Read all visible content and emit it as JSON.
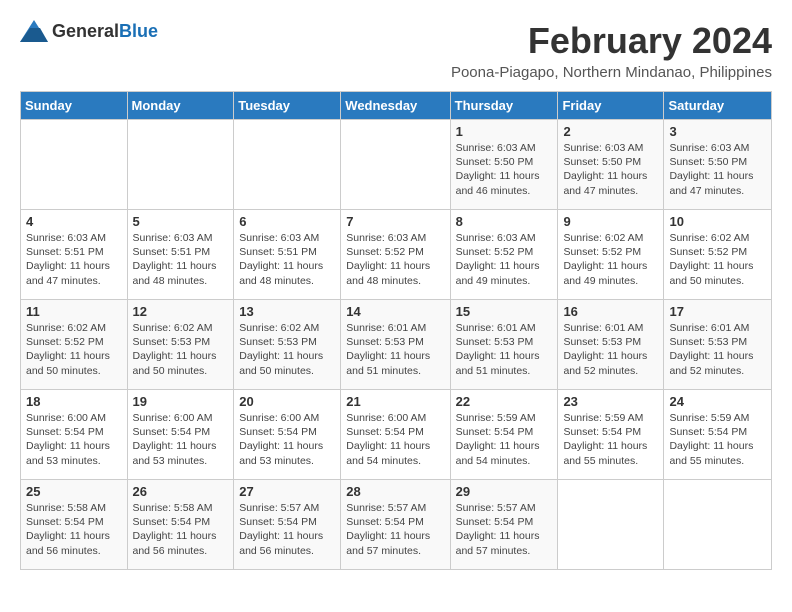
{
  "logo": {
    "general": "General",
    "blue": "Blue"
  },
  "title": "February 2024",
  "location": "Poona-Piagapo, Northern Mindanao, Philippines",
  "weekdays": [
    "Sunday",
    "Monday",
    "Tuesday",
    "Wednesday",
    "Thursday",
    "Friday",
    "Saturday"
  ],
  "weeks": [
    [
      {
        "day": "",
        "info": ""
      },
      {
        "day": "",
        "info": ""
      },
      {
        "day": "",
        "info": ""
      },
      {
        "day": "",
        "info": ""
      },
      {
        "day": "1",
        "info": "Sunrise: 6:03 AM\nSunset: 5:50 PM\nDaylight: 11 hours and 46 minutes."
      },
      {
        "day": "2",
        "info": "Sunrise: 6:03 AM\nSunset: 5:50 PM\nDaylight: 11 hours and 47 minutes."
      },
      {
        "day": "3",
        "info": "Sunrise: 6:03 AM\nSunset: 5:50 PM\nDaylight: 11 hours and 47 minutes."
      }
    ],
    [
      {
        "day": "4",
        "info": "Sunrise: 6:03 AM\nSunset: 5:51 PM\nDaylight: 11 hours and 47 minutes."
      },
      {
        "day": "5",
        "info": "Sunrise: 6:03 AM\nSunset: 5:51 PM\nDaylight: 11 hours and 48 minutes."
      },
      {
        "day": "6",
        "info": "Sunrise: 6:03 AM\nSunset: 5:51 PM\nDaylight: 11 hours and 48 minutes."
      },
      {
        "day": "7",
        "info": "Sunrise: 6:03 AM\nSunset: 5:52 PM\nDaylight: 11 hours and 48 minutes."
      },
      {
        "day": "8",
        "info": "Sunrise: 6:03 AM\nSunset: 5:52 PM\nDaylight: 11 hours and 49 minutes."
      },
      {
        "day": "9",
        "info": "Sunrise: 6:02 AM\nSunset: 5:52 PM\nDaylight: 11 hours and 49 minutes."
      },
      {
        "day": "10",
        "info": "Sunrise: 6:02 AM\nSunset: 5:52 PM\nDaylight: 11 hours and 50 minutes."
      }
    ],
    [
      {
        "day": "11",
        "info": "Sunrise: 6:02 AM\nSunset: 5:52 PM\nDaylight: 11 hours and 50 minutes."
      },
      {
        "day": "12",
        "info": "Sunrise: 6:02 AM\nSunset: 5:53 PM\nDaylight: 11 hours and 50 minutes."
      },
      {
        "day": "13",
        "info": "Sunrise: 6:02 AM\nSunset: 5:53 PM\nDaylight: 11 hours and 50 minutes."
      },
      {
        "day": "14",
        "info": "Sunrise: 6:01 AM\nSunset: 5:53 PM\nDaylight: 11 hours and 51 minutes."
      },
      {
        "day": "15",
        "info": "Sunrise: 6:01 AM\nSunset: 5:53 PM\nDaylight: 11 hours and 51 minutes."
      },
      {
        "day": "16",
        "info": "Sunrise: 6:01 AM\nSunset: 5:53 PM\nDaylight: 11 hours and 52 minutes."
      },
      {
        "day": "17",
        "info": "Sunrise: 6:01 AM\nSunset: 5:53 PM\nDaylight: 11 hours and 52 minutes."
      }
    ],
    [
      {
        "day": "18",
        "info": "Sunrise: 6:00 AM\nSunset: 5:54 PM\nDaylight: 11 hours and 53 minutes."
      },
      {
        "day": "19",
        "info": "Sunrise: 6:00 AM\nSunset: 5:54 PM\nDaylight: 11 hours and 53 minutes."
      },
      {
        "day": "20",
        "info": "Sunrise: 6:00 AM\nSunset: 5:54 PM\nDaylight: 11 hours and 53 minutes."
      },
      {
        "day": "21",
        "info": "Sunrise: 6:00 AM\nSunset: 5:54 PM\nDaylight: 11 hours and 54 minutes."
      },
      {
        "day": "22",
        "info": "Sunrise: 5:59 AM\nSunset: 5:54 PM\nDaylight: 11 hours and 54 minutes."
      },
      {
        "day": "23",
        "info": "Sunrise: 5:59 AM\nSunset: 5:54 PM\nDaylight: 11 hours and 55 minutes."
      },
      {
        "day": "24",
        "info": "Sunrise: 5:59 AM\nSunset: 5:54 PM\nDaylight: 11 hours and 55 minutes."
      }
    ],
    [
      {
        "day": "25",
        "info": "Sunrise: 5:58 AM\nSunset: 5:54 PM\nDaylight: 11 hours and 56 minutes."
      },
      {
        "day": "26",
        "info": "Sunrise: 5:58 AM\nSunset: 5:54 PM\nDaylight: 11 hours and 56 minutes."
      },
      {
        "day": "27",
        "info": "Sunrise: 5:57 AM\nSunset: 5:54 PM\nDaylight: 11 hours and 56 minutes."
      },
      {
        "day": "28",
        "info": "Sunrise: 5:57 AM\nSunset: 5:54 PM\nDaylight: 11 hours and 57 minutes."
      },
      {
        "day": "29",
        "info": "Sunrise: 5:57 AM\nSunset: 5:54 PM\nDaylight: 11 hours and 57 minutes."
      },
      {
        "day": "",
        "info": ""
      },
      {
        "day": "",
        "info": ""
      }
    ]
  ]
}
